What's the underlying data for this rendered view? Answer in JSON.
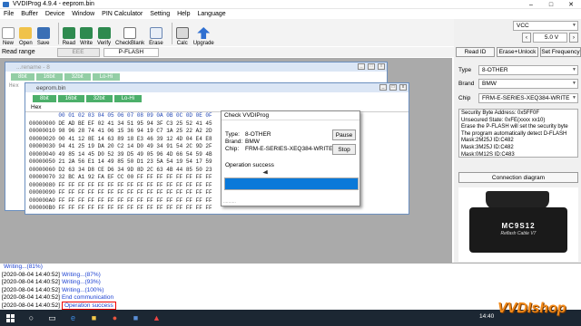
{
  "title": "VVDIProg 4.9.4 - eeprom.bin",
  "menu": [
    "File",
    "Buffer",
    "Device",
    "Window",
    "PIN Calculator",
    "Setting",
    "Help",
    "Language"
  ],
  "toolbar": [
    "New",
    "Open",
    "Save",
    "Read",
    "Write",
    "Verify",
    "CheckBlank",
    "Erase",
    "Calc",
    "Upgrade"
  ],
  "read_range": {
    "label": "Read range",
    "tabs": [
      "EEE",
      "P-FLASH"
    ]
  },
  "win1": {
    "title": "...rename - 8"
  },
  "win2": {
    "title": "eeprom.bin",
    "tabs": [
      "8bit",
      "16bit",
      "32bit",
      "Lo-Hi"
    ],
    "hex_label": "Hex",
    "header": "         00 01 02 03 04 05 06 07 08 09 0A 0B 0C 0D 0E 0F",
    "rows": [
      "00000000 DE AD BE EF 02 41 34 51 95 94 3F C3 25 52 41 45",
      "00000010 98 96 28 74 41 06 15 36 94 19 C7 1A 25 22 A2 2D",
      "00000020 00 41 12 8E 14 63 89 18 E3 46 39 12 4D 04 E4 E8",
      "00000030 94 41 25 19 DA 20 C2 14 D0 49 34 91 54 2C 9D 2F",
      "00000040 49 85 14 45 D0 52 39 D5 49 05 96 4D 66 54 59 4B",
      "00000050 21 2A 56 E1 14 49 85 50 D1 23 5A 54 19 54 17 59",
      "00000060 D2 63 34 D8 CE D6 34 9D 8D 2C 63 4B 44 85 50 23",
      "00000070 32 BC A1 92 FA EF CC 00 FF FF FF FF FF FF FF FF",
      "00000080 FF FF FF FF FF FF FF FF FF FF FF FF FF FF FF FF",
      "00000090 FF FF FF FF FF FF FF FF FF FF FF FF FF FF FF FF",
      "000000A0 FF FF FF FF FF FF FF FF FF FF FF FF FF FF FF FF",
      "000000B0 FF FF FF FF FF FF FF FF FF FF FF FF FF FF FF FF"
    ]
  },
  "dialog": {
    "title": "Check VVDIProg",
    "type_label": "Type:",
    "type": "8-OTHER",
    "brand_label": "Brand:",
    "brand": "BMW",
    "chip_label": "Chip:",
    "chip": "FRM-E-SERIES-XEQ384-WRITE",
    "status": "Operation success",
    "pause": "Pause",
    "stop": "Stop",
    "progress": 1.0
  },
  "right": {
    "vcc": "VCC",
    "voltage": "5.0 V",
    "read_id": "Read ID",
    "erase_unlock": "Erase+Unlock",
    "set_freq": "Set Frequency",
    "type_label": "Type",
    "type": "8-OTHER",
    "brand_label": "Brand",
    "brand": "BMW",
    "chip_label": "Chip",
    "chip": "FRM-E-SERIES-XEQ384-WRITE",
    "info": [
      "Security Byte Address: 0x5FF0F",
      "Unsecured State: 0xFE(xxxx xx10)",
      "Erase the P-FLASH will set the security byte",
      "The program automatically detect D-FLASH",
      "Mask:2M25J ID:C482",
      "Mask:3M25J ID:C482",
      "Mask:0M12S ID:C483"
    ],
    "connection": "Connection diagram",
    "device_text1": "MC9S12",
    "device_text2": "Reflash Cable V7"
  },
  "log": [
    {
      "time": "",
      "msg": "Writing...(81%)"
    },
    {
      "time": "[2020-08-04 14:40:52]",
      "msg": "Writing...(87%)"
    },
    {
      "time": "[2020-08-04 14:40:52]",
      "msg": "Writing...(93%)"
    },
    {
      "time": "[2020-08-04 14:40:52]",
      "msg": "Writing...(100%)"
    },
    {
      "time": "[2020-08-04 14:40:52]",
      "msg": "End communication"
    },
    {
      "time": "[2020-08-04 14:40:52]",
      "msg": "Operation success"
    }
  ],
  "clock": "14:40",
  "watermark": "VVDIshop"
}
